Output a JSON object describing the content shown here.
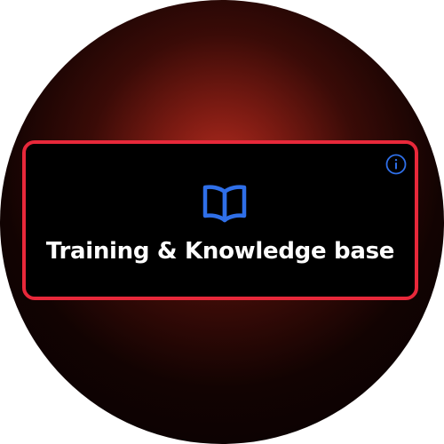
{
  "tile": {
    "title": "Training & Knowledge base",
    "icon": "book-open-icon",
    "info_icon": "info-icon"
  },
  "colors": {
    "tile_border": "#e8283a",
    "tile_background": "#000000",
    "icon_blue": "#2f6fe8",
    "title_text": "#ffffff",
    "background_glow": "#b02a1e"
  }
}
